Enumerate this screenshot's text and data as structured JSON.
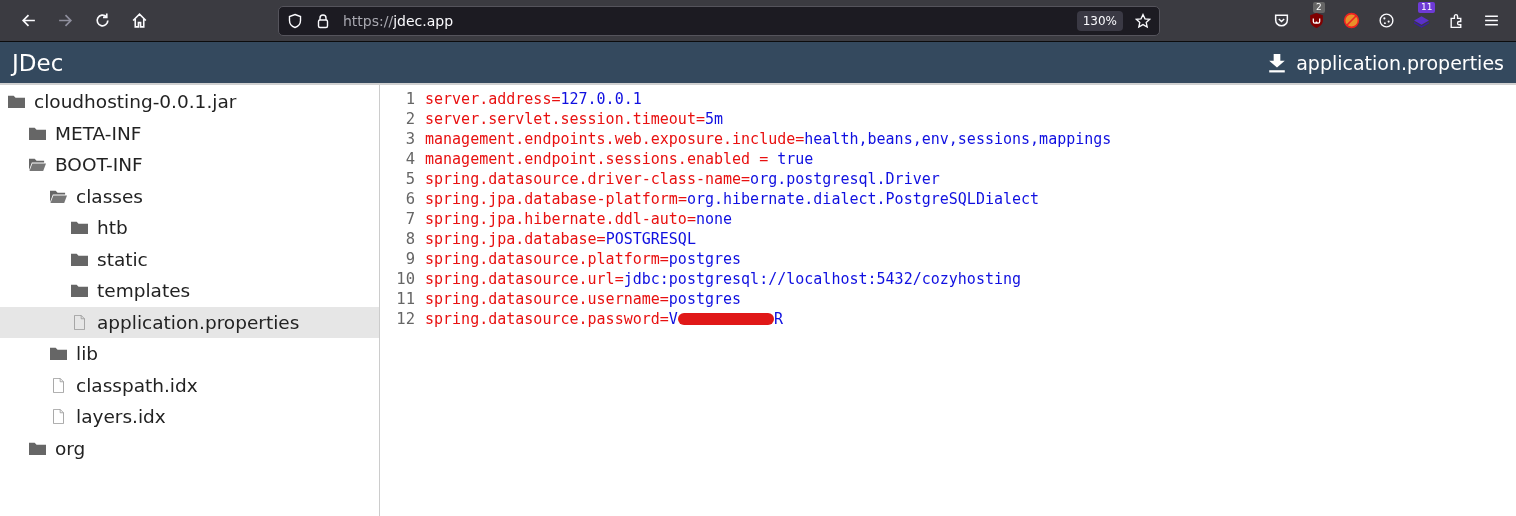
{
  "browser": {
    "url_scheme": "https://",
    "url_host": "jdec.app",
    "zoom": "130%",
    "badges": [
      {
        "kind": "shield",
        "count": "2"
      },
      {
        "kind": "stack",
        "count": "11"
      }
    ]
  },
  "app": {
    "title": "JDec",
    "download": "application.properties"
  },
  "tree": [
    {
      "label": "cloudhosting-0.0.1.jar",
      "kind": "folder",
      "selected": false,
      "children": [
        {
          "label": "META-INF",
          "kind": "folder",
          "selected": false
        },
        {
          "label": "BOOT-INF",
          "kind": "folder-open",
          "selected": false,
          "children": [
            {
              "label": "classes",
              "kind": "folder-open",
              "selected": false,
              "children": [
                {
                  "label": "htb",
                  "kind": "folder",
                  "selected": false
                },
                {
                  "label": "static",
                  "kind": "folder",
                  "selected": false
                },
                {
                  "label": "templates",
                  "kind": "folder",
                  "selected": false
                },
                {
                  "label": "application.properties",
                  "kind": "file",
                  "selected": true
                }
              ]
            },
            {
              "label": "lib",
              "kind": "folder",
              "selected": false
            },
            {
              "label": "classpath.idx",
              "kind": "file",
              "selected": false
            },
            {
              "label": "layers.idx",
              "kind": "file",
              "selected": false
            }
          ]
        },
        {
          "label": "org",
          "kind": "folder",
          "selected": false
        }
      ]
    }
  ],
  "code": [
    {
      "n": "1",
      "key": "server.address",
      "sep": "=",
      "value": "127.0.0.1"
    },
    {
      "n": "2",
      "key": "server.servlet.session.timeout",
      "sep": "=",
      "value": "5m"
    },
    {
      "n": "3",
      "key": "management.endpoints.web.exposure.include",
      "sep": "=",
      "value": "health,beans,env,sessions,mappings"
    },
    {
      "n": "4",
      "key": "management.endpoint.sessions.enabled",
      "sep": " = ",
      "value": "true"
    },
    {
      "n": "5",
      "key": "spring.datasource.driver-class-name",
      "sep": "=",
      "value": "org.postgresql.Driver"
    },
    {
      "n": "6",
      "key": "spring.jpa.database-platform",
      "sep": "=",
      "value": "org.hibernate.dialect.PostgreSQLDialect"
    },
    {
      "n": "7",
      "key": "spring.jpa.hibernate.ddl-auto",
      "sep": "=",
      "value": "none"
    },
    {
      "n": "8",
      "key": "spring.jpa.database",
      "sep": "=",
      "value": "POSTGRESQL"
    },
    {
      "n": "9",
      "key": "spring.datasource.platform",
      "sep": "=",
      "value": "postgres"
    },
    {
      "n": "10",
      "key": "spring.datasource.url",
      "sep": "=",
      "value": "jdbc:postgresql://localhost:5432/cozyhosting"
    },
    {
      "n": "11",
      "key": "spring.datasource.username",
      "sep": "=",
      "value": "postgres"
    },
    {
      "n": "12",
      "key": "spring.datasource.password",
      "sep": "=",
      "value": "V",
      "redacted": true,
      "value_after": "R"
    }
  ]
}
